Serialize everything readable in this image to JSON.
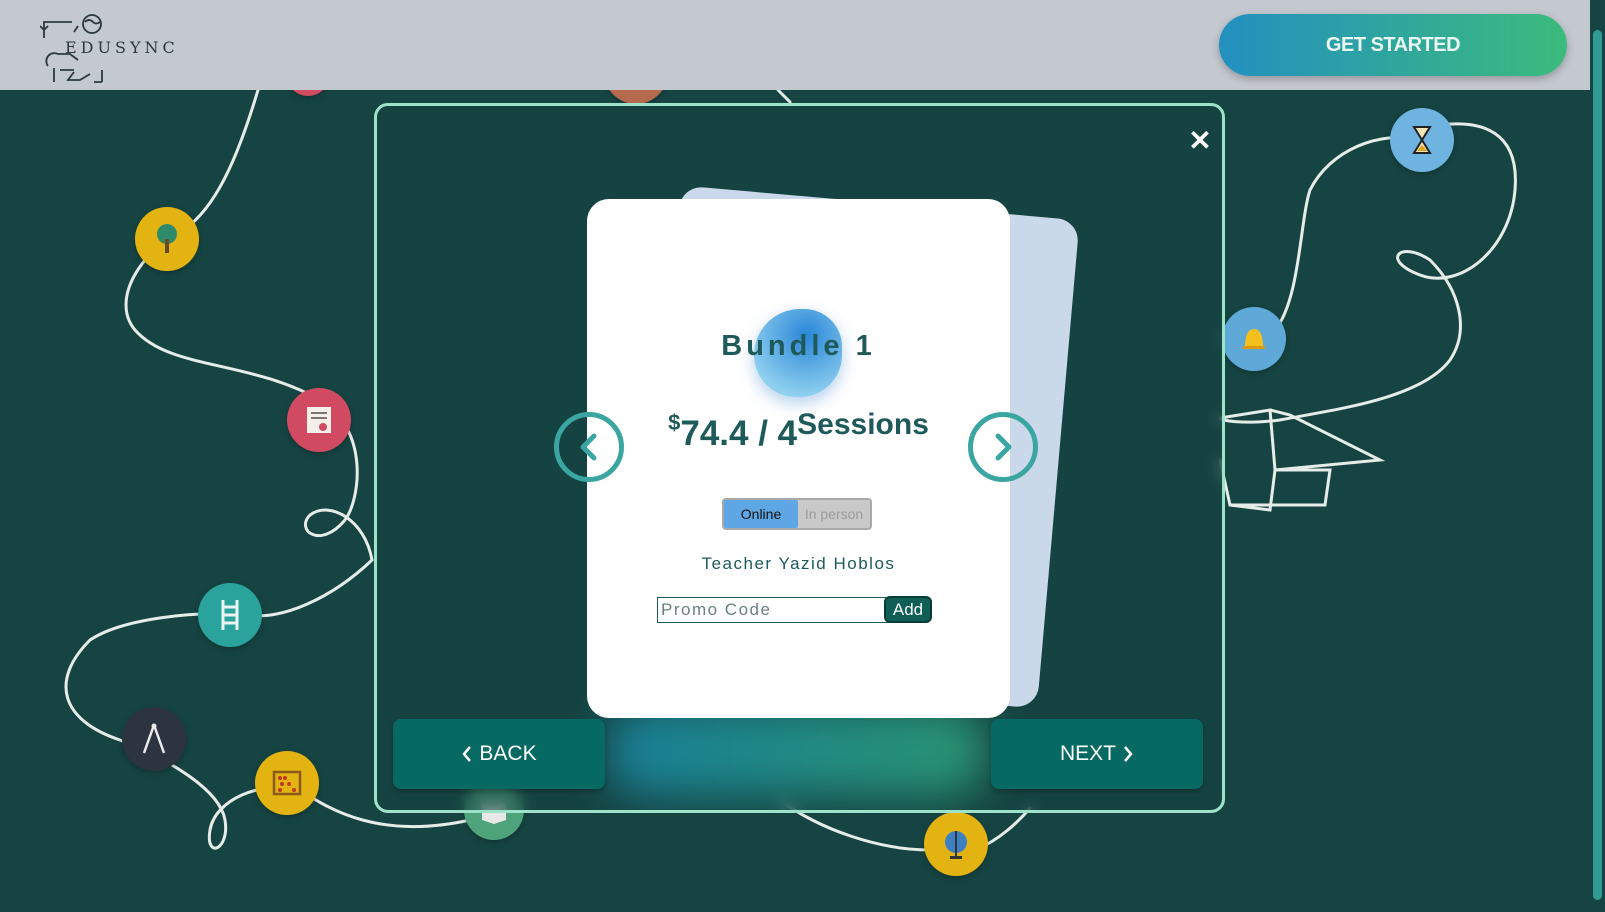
{
  "header": {
    "logo_text": "EDUSYNC",
    "cta_label": "GET STARTED"
  },
  "modal": {
    "close_symbol": "✕",
    "bundle": {
      "title": "Bundle 1",
      "currency": "$",
      "price": "74.4 / 4",
      "unit": "Sessions",
      "mode_options": [
        "Online",
        "In person"
      ],
      "selected_mode": "Online",
      "teacher": "Teacher Yazid Hoblos",
      "promo_placeholder": "Promo Code",
      "add_label": "Add"
    },
    "back_label": "BACK",
    "next_label": "NEXT"
  },
  "icons": {
    "background": [
      "tree-icon",
      "certificate-icon",
      "ladder-icon",
      "compass-icon",
      "abacus-icon",
      "hourglass-icon",
      "bell-icon",
      "globe-icon",
      "book-icon",
      "lightbulb-icon",
      "graduation-cap-icon"
    ],
    "colors": {
      "accent": "#3ba6a1",
      "cta_gradient_start": "#2390c0",
      "cta_gradient_end": "#3bbb7c",
      "background": "#164442",
      "modal_border": "#9ee3c9",
      "button_dark": "#066a63"
    }
  }
}
